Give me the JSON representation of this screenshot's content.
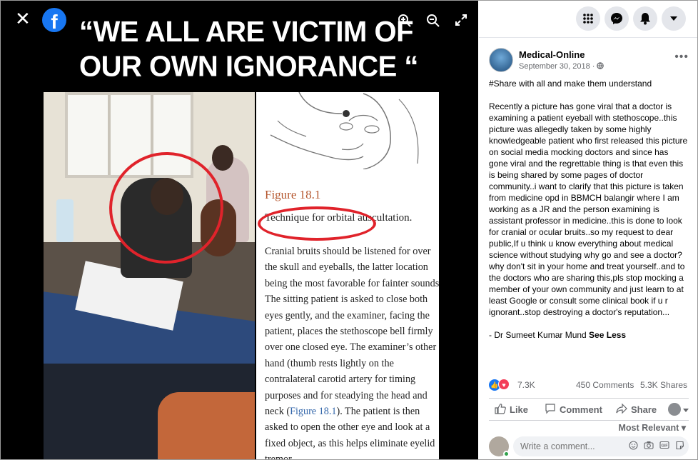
{
  "viewer": {
    "close_glyph": "✕",
    "headline_line1": "“WE ALL ARE VICTIM OF",
    "headline_line2": "OUR OWN IGNORANCE “",
    "zoom_in_icon": "zoom-in-icon",
    "zoom_out_icon": "zoom-out-icon",
    "fullscreen_icon": "fullscreen-icon"
  },
  "book": {
    "figure_label": "Figure 18.1",
    "caption": "Technique for orbital auscultation.",
    "body_before": "Cranial bruits should be listened for over the skull and eyeballs, the latter location being the most favorable for fainter sounds. The sitting patient is asked to close both eyes gently, and the examiner, facing the patient, places the stethoscope bell firmly over one closed eye. The examiner’s other hand (thumb rests lightly on the contralateral carotid artery for timing purposes and for steadying the head and neck (",
    "body_link": "Figure 18.1",
    "body_after": "). The patient is then asked to open the other eye and look at a fixed object, as this helps eliminate eyelid tremor."
  },
  "topbar": {
    "menu_icon": "grid-menu-icon",
    "messenger_icon": "messenger-icon",
    "notifications_icon": "bell-icon",
    "account_icon": "caret-down-icon"
  },
  "post": {
    "page_name": "Medical-Online",
    "date": "September 30, 2018 · ",
    "more": "•••",
    "hashtag": "#Share",
    "first_line": " with all and make them understand",
    "body": "Recently a picture has gone viral that a doctor is examining a patient eyeball with stethoscope..this picture was allegedly taken by some highly knowledgeable patient who first released this picture on social media mocking doctors and since has gone viral and the regrettable thing is that even this is being shared by some pages of doctor community..i want to clarify that this picture is taken from medicine opd in BBMCH balangir where I am working as a JR and the person examining is assistant professor in medicine..this is done to look for cranial or ocular bruits..so my request to dear public,If u think u know everything about medical science without studying why go and see a doctor?why don't sit in your home and treat yourself..and to the doctors who are sharing this,pls stop mocking a member of your own community and just learn to at least Google or consult some clinical book if u r ignorant..stop destroying a doctor's reputation...",
    "signature": "- Dr Sumeet Kumar Mund ",
    "see_less": "See Less"
  },
  "reactions": {
    "count": "7.3K",
    "comments": "450 Comments",
    "shares": "5.3K Shares"
  },
  "actions": {
    "like": "Like",
    "comment": "Comment",
    "share": "Share"
  },
  "comments": {
    "sort_label": "Most Relevant ▾",
    "placeholder": "Write a comment..."
  }
}
